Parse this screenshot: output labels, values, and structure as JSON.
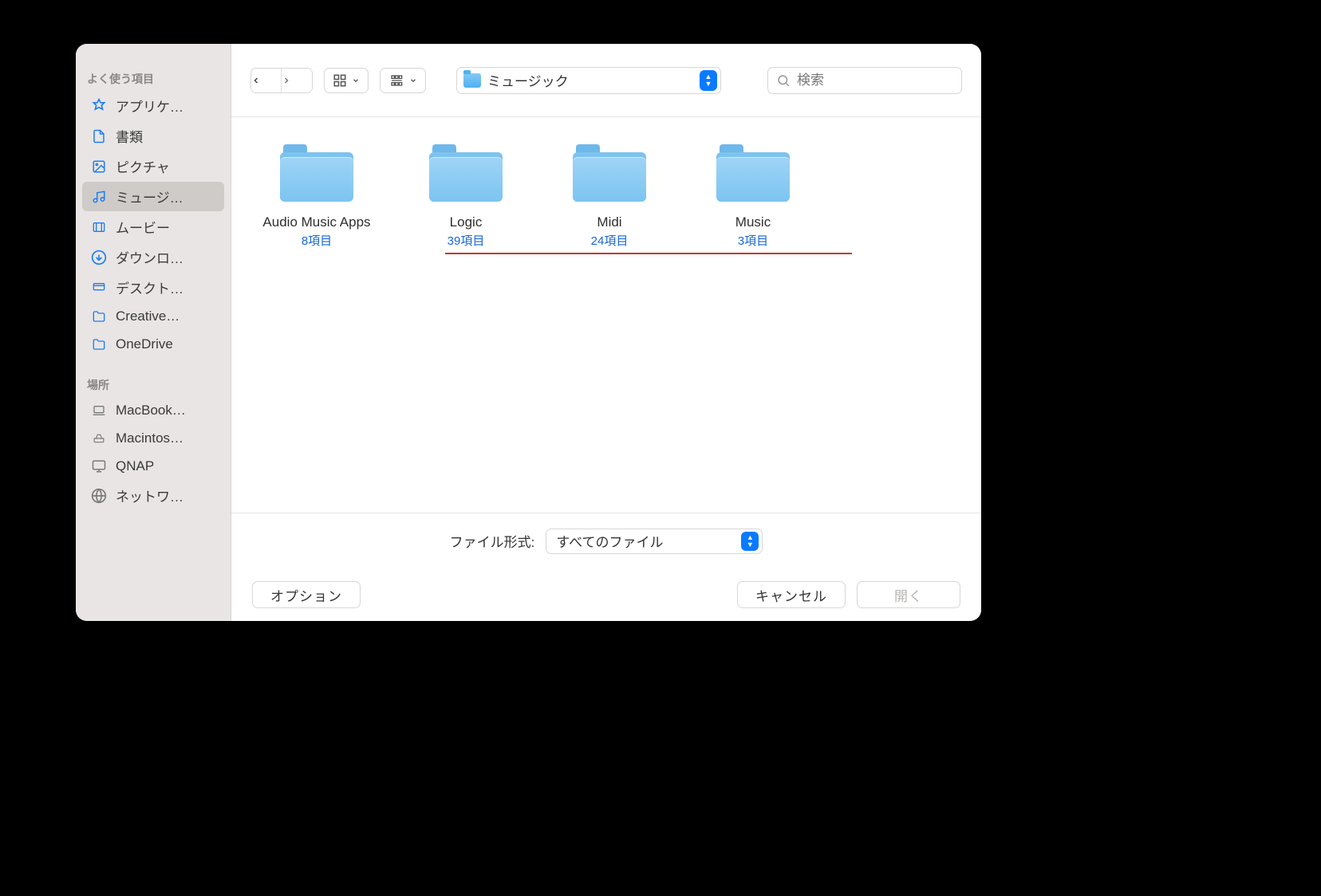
{
  "sidebar": {
    "favorites_header": "よく使う項目",
    "locations_header": "場所",
    "favorites": [
      {
        "id": "applications",
        "label": "アプリケ…"
      },
      {
        "id": "documents",
        "label": "書類"
      },
      {
        "id": "pictures",
        "label": "ピクチャ"
      },
      {
        "id": "music",
        "label": "ミュージ…",
        "selected": true
      },
      {
        "id": "movies",
        "label": "ムービー"
      },
      {
        "id": "downloads",
        "label": "ダウンロ…"
      },
      {
        "id": "desktop",
        "label": "デスクト…"
      },
      {
        "id": "creative",
        "label": "Creative…"
      },
      {
        "id": "onedrive",
        "label": "OneDrive"
      }
    ],
    "locations": [
      {
        "id": "macbook",
        "label": "MacBook…"
      },
      {
        "id": "macintosh",
        "label": "Macintos…"
      },
      {
        "id": "qnap",
        "label": "QNAP"
      },
      {
        "id": "network",
        "label": "ネットワ…"
      }
    ]
  },
  "toolbar": {
    "current_path_label": "ミュージック",
    "search_placeholder": "検索"
  },
  "folders": [
    {
      "name": "Audio Music Apps",
      "count": "8項目"
    },
    {
      "name": "Logic",
      "count": "39項目"
    },
    {
      "name": "Midi",
      "count": "24項目"
    },
    {
      "name": "Music",
      "count": "3項目"
    }
  ],
  "format": {
    "label": "ファイル形式:",
    "value": "すべてのファイル"
  },
  "buttons": {
    "options": "オプション",
    "cancel": "キャンセル",
    "open": "開く"
  }
}
